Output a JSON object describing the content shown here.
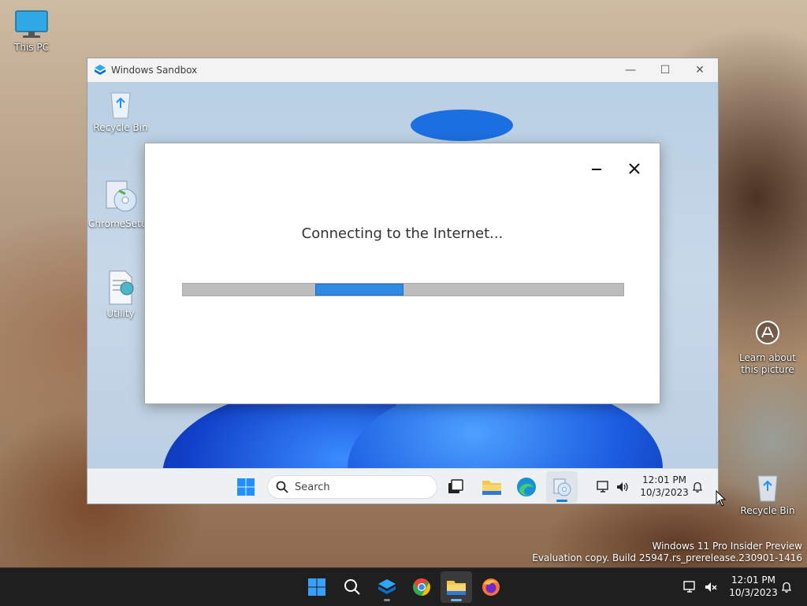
{
  "host_desktop": {
    "icons": [
      {
        "name": "This PC"
      },
      {
        "name": "Learn about this picture"
      },
      {
        "name": "Recycle Bin"
      }
    ],
    "watermark": {
      "line1": "Windows 11 Pro Insider Preview",
      "line2": "Evaluation copy. Build 25947.rs_prerelease.230901-1416"
    }
  },
  "sandbox": {
    "title": "Windows Sandbox",
    "controls": {
      "minimize": "—",
      "maximize": "☐",
      "close": "✕"
    },
    "desktop_icons": [
      {
        "name": "Recycle Bin"
      },
      {
        "name": "ChromeSetup"
      },
      {
        "name": "Utility"
      }
    ],
    "taskbar": {
      "search_placeholder": "Search",
      "time": "12:01 PM",
      "date": "10/3/2023"
    },
    "dialog": {
      "message": "Connecting to the Internet...",
      "progress": {
        "chunk_start": 0.3,
        "chunk_end": 0.5
      }
    }
  },
  "host_taskbar": {
    "time": "12:01 PM",
    "date": "10/3/2023"
  },
  "colors": {
    "accent": "#2f8ae6",
    "windows_blue": "#1e90ff",
    "taskbar_dark": "#1f1f1f"
  }
}
